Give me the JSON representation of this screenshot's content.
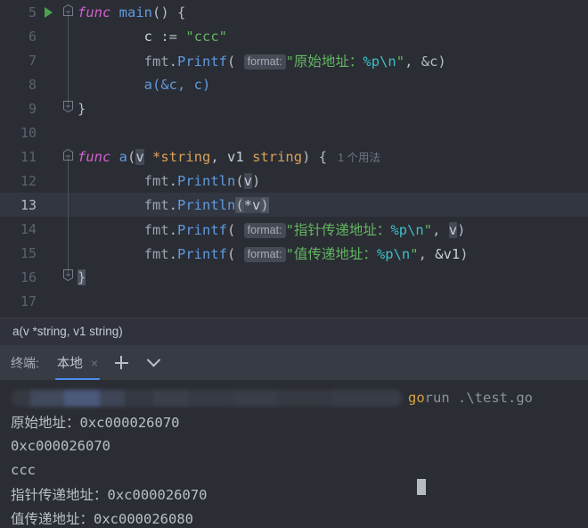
{
  "editor": {
    "lines": [
      {
        "num": "5",
        "run": true,
        "fold": "start",
        "caret": false
      },
      {
        "num": "6",
        "run": false,
        "fold": "mid",
        "caret": false
      },
      {
        "num": "7",
        "run": false,
        "fold": "mid",
        "caret": false
      },
      {
        "num": "8",
        "run": false,
        "fold": "mid",
        "caret": false
      },
      {
        "num": "9",
        "run": false,
        "fold": "end",
        "caret": false
      },
      {
        "num": "10",
        "run": false,
        "fold": "none",
        "caret": false
      },
      {
        "num": "11",
        "run": false,
        "fold": "start",
        "caret": false
      },
      {
        "num": "12",
        "run": false,
        "fold": "mid",
        "caret": false
      },
      {
        "num": "13",
        "run": false,
        "fold": "mid",
        "caret": true
      },
      {
        "num": "14",
        "run": false,
        "fold": "mid",
        "caret": false
      },
      {
        "num": "15",
        "run": false,
        "fold": "mid",
        "caret": false
      },
      {
        "num": "16",
        "run": false,
        "fold": "end",
        "caret": false
      },
      {
        "num": "17",
        "run": false,
        "fold": "none",
        "caret": false
      }
    ],
    "code": {
      "l5_func": "func",
      "l5_name": "main",
      "l5_tail": "() {",
      "l6_var": "c",
      "l6_op": ":=",
      "l6_str": "\"ccc\"",
      "l7_pkg": "fmt",
      "l7_meth": "Printf",
      "l7_hint": "format:",
      "l7_str": "\"原始地址：",
      "l7_fmt": "%p\\n",
      "l7_strend": "\"",
      "l7_args": ", &c)",
      "l8_call": "a(&c, c)",
      "l9_brace": "}",
      "l11_func": "func",
      "l11_name": "a",
      "l11_p1": "v",
      "l11_t1": "*string",
      "l11_p2": "v1",
      "l11_t2": "string",
      "l11_usage": "1 个用法",
      "l12_pkg": "fmt",
      "l12_meth": "Println",
      "l12_arg": "v",
      "l13_pkg": "fmt",
      "l13_meth": "Println",
      "l13_arg": "*v",
      "l14_pkg": "fmt",
      "l14_meth": "Printf",
      "l14_hint": "format:",
      "l14_str": "\"指针传递地址：",
      "l14_fmt": "%p\\n",
      "l14_strend": "\"",
      "l14_arg": "v",
      "l15_pkg": "fmt",
      "l15_meth": "Printf",
      "l15_hint": "format:",
      "l15_str": "\"值传递地址：",
      "l15_fmt": "%p\\n",
      "l15_strend": "\"",
      "l15_arg": "&v1",
      "l16_brace": "}"
    }
  },
  "breadcrumb": {
    "text": "a(v *string, v1 string)"
  },
  "terminal": {
    "label": "终端:",
    "tab_name": "本地",
    "close_glyph": "×",
    "output": {
      "cmd_go": "go",
      "cmd_rest": "run .\\test.go",
      "line1": "原始地址：0xc000026070",
      "line2": "0xc000026070",
      "line3": "ccc",
      "line4": "指针传递地址：0xc000026070",
      "line5": "值传递地址：0xc000026080"
    }
  },
  "colors": {
    "editor_bg": "#2b2d34",
    "caret_line": "#323640",
    "tab_bar": "#373b43",
    "accent_blue": "#4a8df0",
    "run_green": "#4aa352",
    "keyword": "#d45fd0",
    "string": "#62b562",
    "format": "#3fbdc4",
    "type": "#d9a05b",
    "func_name": "#5f9ae0",
    "terminal_go": "#d8a341"
  }
}
